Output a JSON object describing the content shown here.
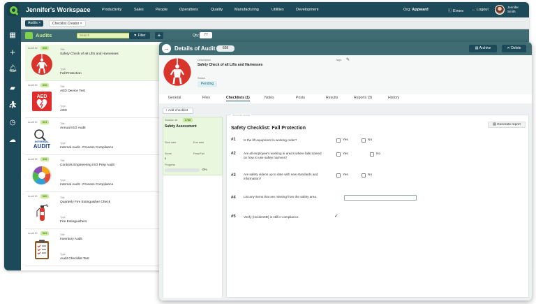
{
  "app": {
    "workspace_title": "Jennifer's Workspace",
    "nav": [
      "Productivity",
      "Sales",
      "People",
      "Operations",
      "Quality",
      "Manufacturing",
      "Utilities",
      "Development"
    ],
    "org_label": "Org:",
    "org_name": "Appward",
    "errors_label": "Errors",
    "logout_label": "Logout",
    "user_first": "Jennifer",
    "user_last": "Smith"
  },
  "tabs": {
    "audits": "Audits",
    "checklist_creator": "Checklist Creator",
    "close": "×"
  },
  "audits_bar": {
    "title": "Audits",
    "search_placeholder": "Search",
    "filter_label": "Filter",
    "add_label": "+",
    "qty_label": "Qty:",
    "qty_value": "77"
  },
  "list": {
    "audit_id_label": "Audit ID",
    "title_label": "Title",
    "type_label": "Type",
    "items": [
      {
        "id": "608",
        "title": "Safety Check of all Lifts and Harnesses",
        "type": "Fall Protection"
      },
      {
        "id": "606",
        "title": "AED Device Test",
        "type": "AED"
      },
      {
        "id": "604",
        "title": "Annual ISO Audit",
        "type": "Internal Audit - Process Compliance"
      },
      {
        "id": "598",
        "title": "Controls Engineering ISO Prep Audit",
        "type": "Internal Audit - Process Compliance"
      },
      {
        "id": "585",
        "title": "Quarterly Fire Extinguisher Check",
        "type": "Fire Extinguishers"
      },
      {
        "id": "584",
        "title": "Inventory Audit",
        "type": "Audit Checklist Test"
      }
    ]
  },
  "thumb_text": {
    "aed": "AED",
    "internal": "INTERNAL",
    "audit": "AUDIT"
  },
  "detail": {
    "title": "Details of Audit",
    "id": "608",
    "archive_label": "Archive",
    "delete_label": "Delete",
    "description_label": "Description",
    "description": "Safety Check of all Lifts and Harnesses",
    "tags_label": "Tags",
    "status_label": "Status",
    "status": "Pending",
    "tabs": [
      "General",
      "Files",
      "Checklists (1)",
      "Notes",
      "Posts",
      "Results",
      "Reports (3)",
      "History"
    ],
    "add_checklist": "Add checklist",
    "session": {
      "id_label": "Session ID",
      "id": "1756",
      "name": "Safety Assessment",
      "start_label": "Start date",
      "end_label": "End date",
      "score_label": "Score",
      "passfail_label": "Pass/Fail",
      "score": "0",
      "progress_label": "Progress",
      "progress_pct": "0%",
      "progress_value": 0
    },
    "checklist": {
      "panel_hint": "Checklist details",
      "title": "Safety Checklist: Fall Protection",
      "generate_report": "Generate report",
      "yes": "Yes",
      "no": "No",
      "questions": [
        {
          "num": "#1",
          "text": "Is the lift equipment in working order?"
        },
        {
          "num": "#2",
          "text": "Are all employee's working in area's where falls trained on how to use saftey harness?"
        },
        {
          "num": "#3",
          "text": "Are safety videos up to date with new standards and information?"
        },
        {
          "num": "#4",
          "text": "List any items that are missing from the safety area."
        },
        {
          "num": "#5",
          "text": "Verify {IncidentID} is still in compliance."
        }
      ]
    }
  },
  "colors": {
    "header": "#1c4a59",
    "accent_green": "#7fd34c",
    "bar": "#3f6b73"
  }
}
